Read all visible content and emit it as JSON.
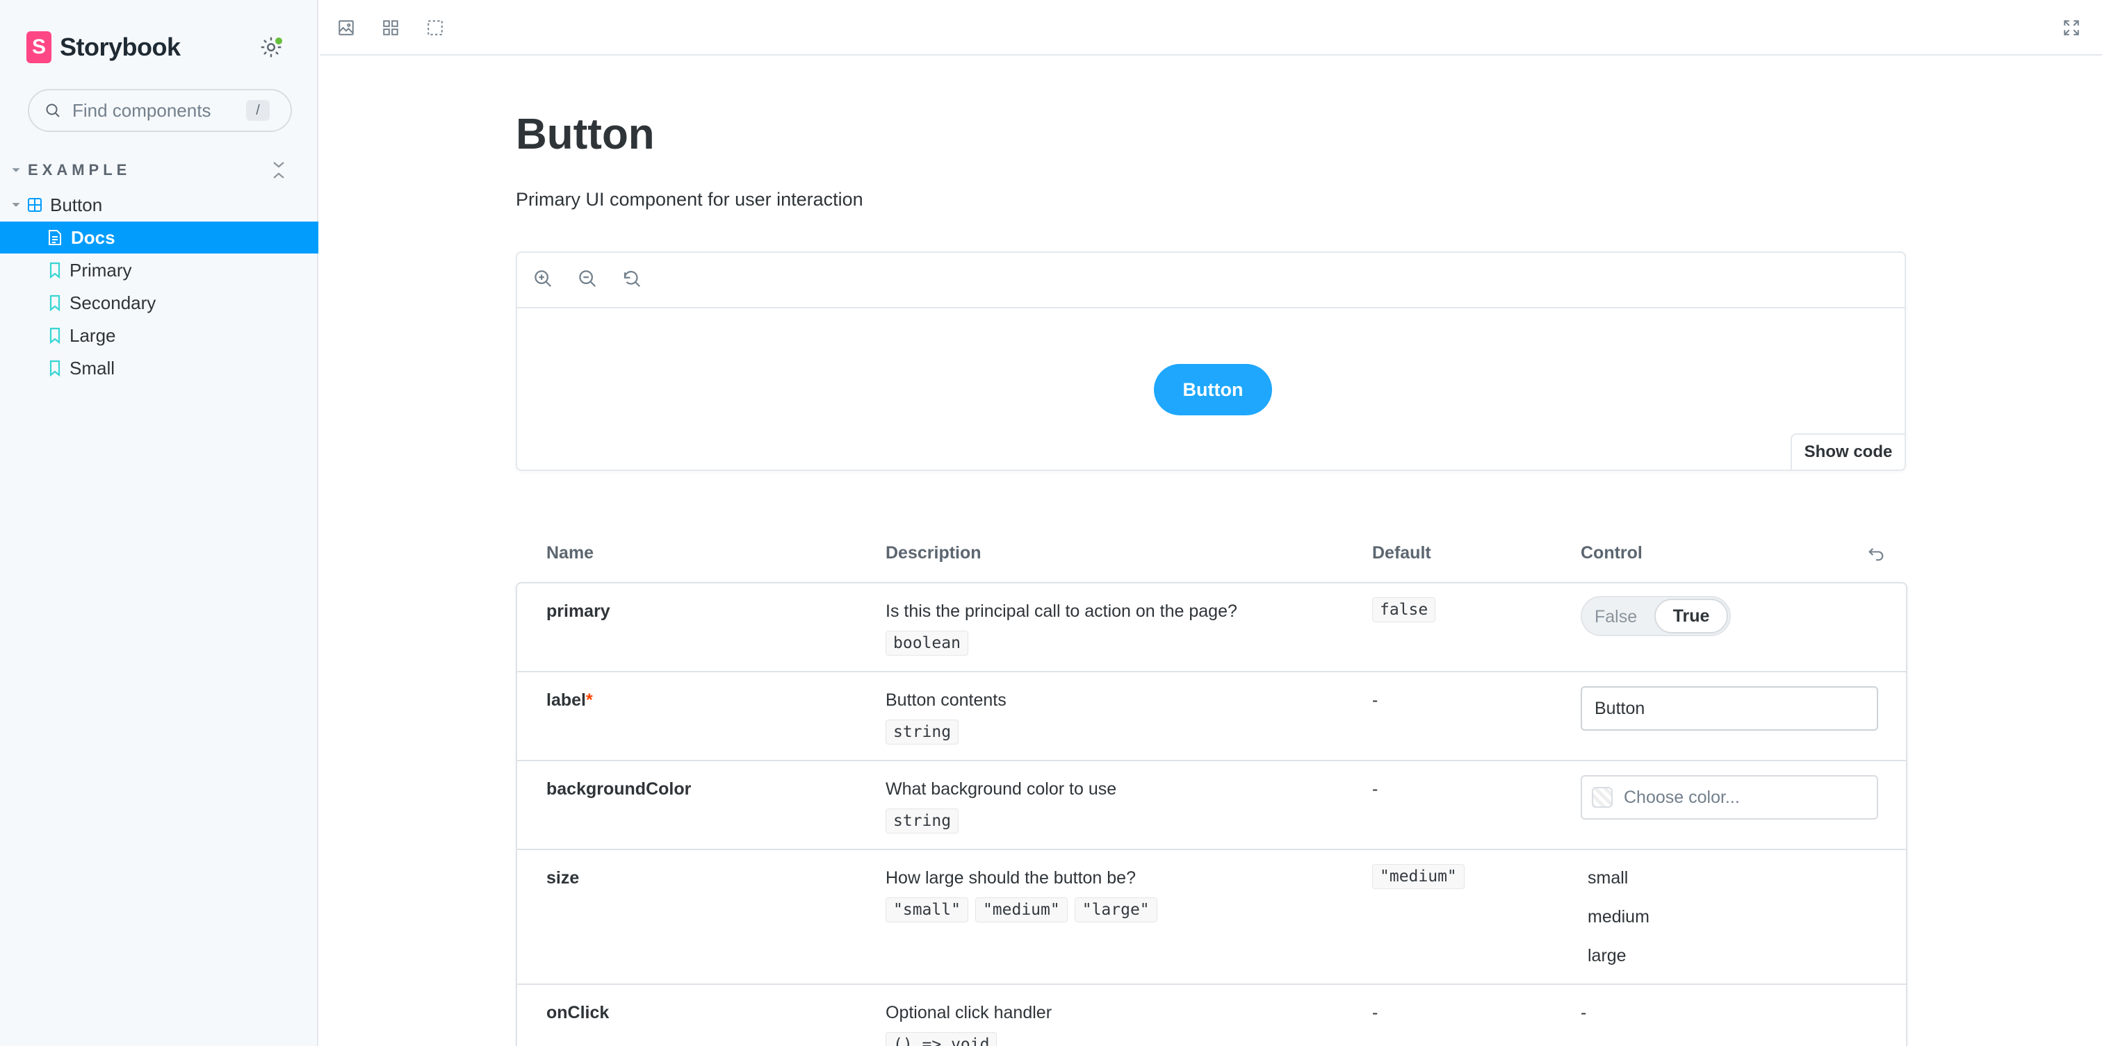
{
  "sidebar": {
    "brand": "Storybook",
    "brand_logo_letter": "S",
    "search_placeholder": "Find components",
    "search_shortcut": "/",
    "section": "EXAMPLE",
    "component": "Button",
    "items": [
      {
        "label": "Docs",
        "icon": "document-icon",
        "selected": true
      },
      {
        "label": "Primary",
        "icon": "bookmark-icon"
      },
      {
        "label": "Secondary",
        "icon": "bookmark-icon"
      },
      {
        "label": "Large",
        "icon": "bookmark-icon"
      },
      {
        "label": "Small",
        "icon": "bookmark-icon"
      }
    ],
    "accent": "#029cfd"
  },
  "toolbar": {
    "tools": [
      "image-icon",
      "grid-icon",
      "outline-icon"
    ],
    "fullscreen": "fullscreen-icon"
  },
  "docs": {
    "title": "Button",
    "subtitle": "Primary UI component for user interaction",
    "canvas": {
      "zoom_tools": [
        "zoom-in-icon",
        "zoom-out-icon",
        "zoom-reset-icon"
      ],
      "preview_button_label": "Button",
      "preview_button_color": "#1ea7fd",
      "show_code_label": "Show code"
    }
  },
  "args_table": {
    "headers": {
      "name": "Name",
      "description": "Description",
      "default": "Default",
      "control": "Control"
    },
    "rows": [
      {
        "name": "primary",
        "description": "Is this the principal call to action on the page?",
        "types": [
          "boolean"
        ],
        "default": "false",
        "control": {
          "type": "toggle",
          "off_label": "False",
          "on_label": "True",
          "value": true
        }
      },
      {
        "name": "label",
        "required_mark": "*",
        "description": "Button contents",
        "types": [
          "string"
        ],
        "default": "-",
        "control": {
          "type": "text",
          "value": "Button"
        }
      },
      {
        "name": "backgroundColor",
        "description": "What background color to use",
        "types": [
          "string"
        ],
        "default": "-",
        "control": {
          "type": "color",
          "placeholder": "Choose color..."
        }
      },
      {
        "name": "size",
        "description": "How large should the button be?",
        "types": [
          "\"small\"",
          "\"medium\"",
          "\"large\""
        ],
        "default": "\"medium\"",
        "control": {
          "type": "radio",
          "options": [
            "small",
            "medium",
            "large"
          ]
        }
      },
      {
        "name": "onClick",
        "description": "Optional click handler",
        "types": [
          "() => void"
        ],
        "default": "-",
        "control": {
          "type": "none",
          "value": "-"
        }
      }
    ]
  }
}
